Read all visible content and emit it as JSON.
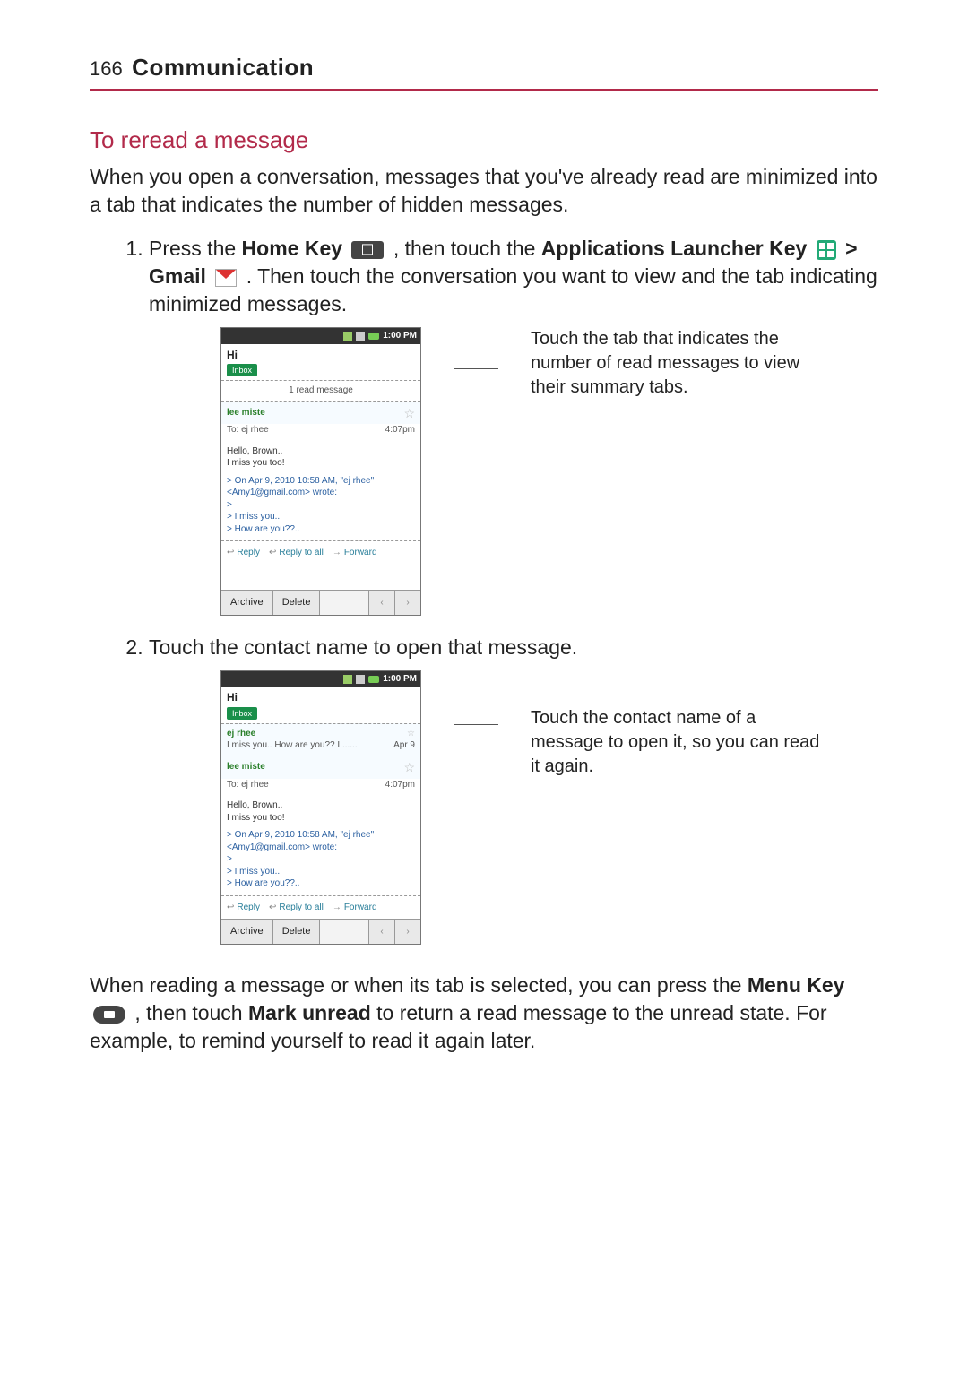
{
  "header": {
    "page_number": "166",
    "chapter": "Communication"
  },
  "section": {
    "title": "To reread a message"
  },
  "intro": "When you open a conversation, messages that you've already read are minimized into a tab that indicates the number of hidden messages.",
  "step1": {
    "t1": "Press the ",
    "home_key": "Home Key",
    "t2": " , then touch the ",
    "apps_launcher": "Applications Launcher Key",
    "gt": " > ",
    "gmail": "Gmail",
    "t3": ". Then touch the conversation you want to view and the tab indicating minimized messages."
  },
  "step2": "Touch the contact name to open that message.",
  "callout1": "Touch the tab that indicates the number of read messages to view their summary tabs.",
  "callout2": "Touch the contact name of a message to open it, so you can read it again.",
  "closing": {
    "t1": "When reading a message or when its tab is selected, you can press the ",
    "menu_key": "Menu Key",
    "t2": " , then touch ",
    "mark_unread": "Mark unread",
    "t3": " to return a read message to the unread state. For example, to remind yourself to read it again later."
  },
  "phone": {
    "status_time": "1:00 PM",
    "thread_title": "Hi",
    "inbox_label": "Inbox",
    "read_tab": "1 read message",
    "contact": {
      "name": "ej rhee",
      "preview": "I miss you.. How are you?? I.......",
      "date": "Apr 9"
    },
    "msg_from": "lee miste",
    "to_line": "To: ej rhee",
    "time": "4:07pm",
    "body_l1": "Hello, Brown..",
    "body_l2": "I miss you too!",
    "quote_intro": "> On Apr 9, 2010 10:58 AM, \"ej rhee\" <Amy1@gmail.com> wrote:",
    "quote_l1": "> I miss you..",
    "quote_l2": "> How are you??..",
    "reply": "Reply",
    "reply_all": "Reply to all",
    "forward": "Forward",
    "archive": "Archive",
    "delete": "Delete",
    "nav_prev": "‹",
    "nav_next": "›"
  }
}
